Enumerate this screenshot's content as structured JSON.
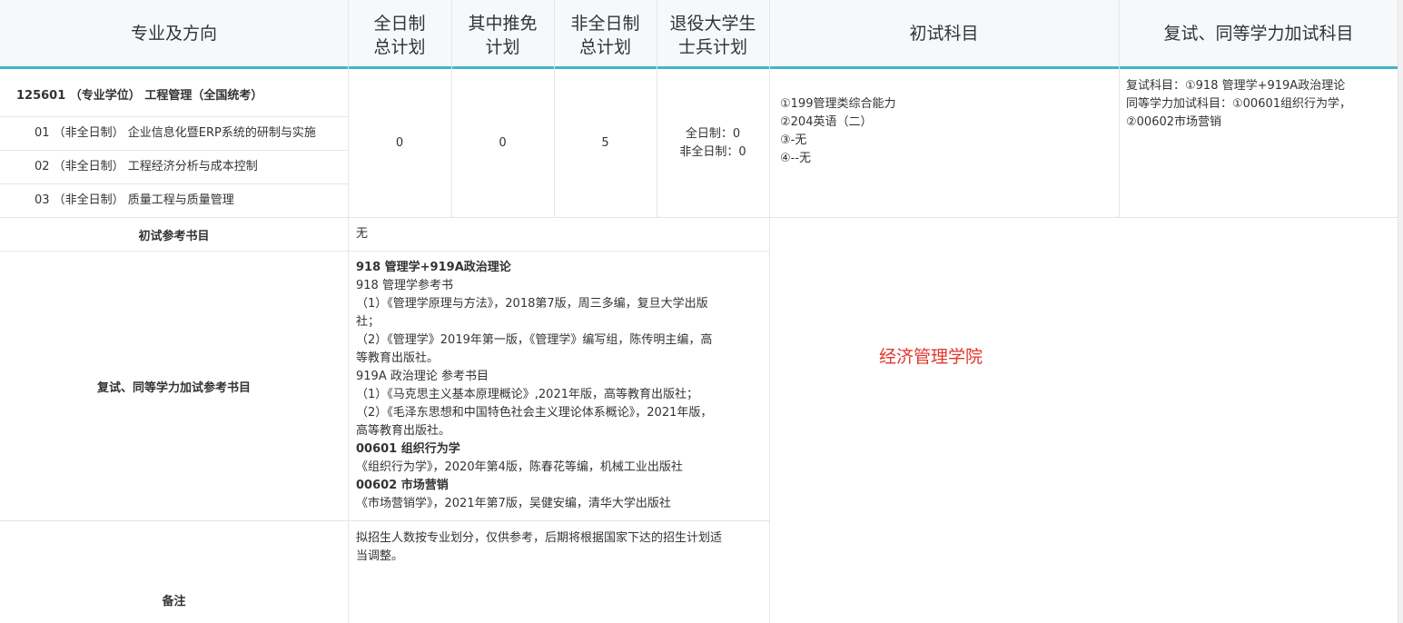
{
  "header": {
    "col_major": "专业及方向",
    "col_fulltime_l1": "全日制",
    "col_fulltime_l2": "总计划",
    "col_exempt_l1": "其中推免",
    "col_exempt_l2": "计划",
    "col_parttime_l1": "非全日制",
    "col_parttime_l2": "总计划",
    "col_veteran_l1": "退役大学生",
    "col_veteran_l2": "士兵计划",
    "col_prelim": "初试科目",
    "col_retest": "复试、同等学力加试科目"
  },
  "program": {
    "title": "125601 （专业学位） 工程管理（全国统考）",
    "directions": [
      "01 （非全日制） 企业信息化暨ERP系统的研制与实施",
      "02 （非全日制） 工程经济分析与成本控制",
      "03 （非全日制） 质量工程与质量管理"
    ],
    "fulltime_plan": "0",
    "exempt_plan": "0",
    "parttime_plan": "5",
    "veteran_plan_l1": "全日制：0",
    "veteran_plan_l2": "非全日制：0",
    "prelim_subjects": [
      "①199管理类综合能力",
      "②204英语（二）",
      "③-无",
      "④--无"
    ],
    "retest_subjects": [
      "复试科目：①918 管理学+919A政治理论",
      "同等学力加试科目：①00601组织行为学，",
      "②00602市场营销"
    ]
  },
  "rows": {
    "prelim_books_label": "初试参考书目",
    "prelim_books_value": "无",
    "retest_books_label": "复试、同等学力加试参考书目",
    "retest_books": [
      {
        "text": "918 管理学+919A政治理论",
        "bold": true
      },
      {
        "text": "918 管理学参考书",
        "bold": false
      },
      {
        "text": "（1）《管理学原理与方法》，2018第7版，周三多编，复旦大学出版",
        "bold": false
      },
      {
        "text": "社；",
        "bold": false
      },
      {
        "text": "（2）《管理学》2019年第一版，《管理学》编写组，陈传明主编，高",
        "bold": false
      },
      {
        "text": "等教育出版社。",
        "bold": false
      },
      {
        "text": "919A 政治理论 参考书目",
        "bold": false
      },
      {
        "text": "（1）《马克思主义基本原理概论》,2021年版，高等教育出版社；",
        "bold": false
      },
      {
        "text": "（2）《毛泽东思想和中国特色社会主义理论体系概论》，2021年版，",
        "bold": false
      },
      {
        "text": "高等教育出版社。",
        "bold": false
      },
      {
        "text": "00601 组织行为学",
        "bold": true
      },
      {
        "text": "《组织行为学》，2020年第4版，陈春花等编，机械工业出版社",
        "bold": false
      },
      {
        "text": "00602 市场营销",
        "bold": true
      },
      {
        "text": "《市场营销学》，2021年第7版，吴健安编，清华大学出版社",
        "bold": false
      }
    ],
    "notes_label": "备注",
    "notes_l1": "拟招生人数按专业划分，仅供参考，后期将根据国家下达的招生计划适",
    "notes_l2": "当调整。"
  },
  "school": "经济管理学院",
  "colors": {
    "accent": "#3fb6c8",
    "school_red": "#e0352b",
    "header_bg": "#f5f9fc"
  }
}
